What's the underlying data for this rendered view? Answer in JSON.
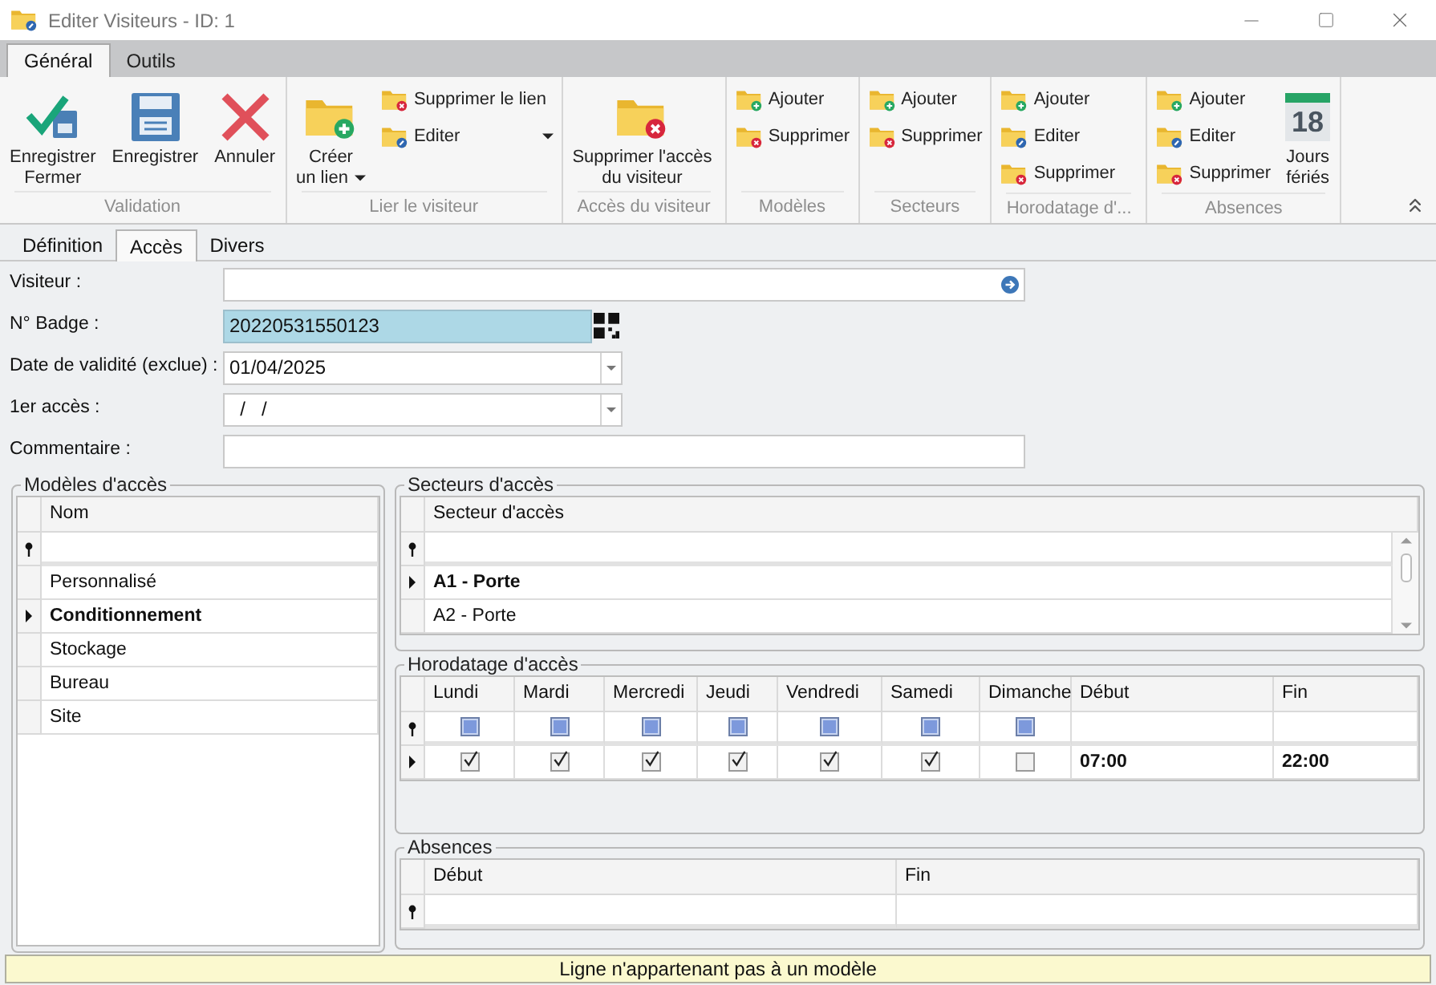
{
  "window": {
    "title": "Editer Visiteurs - ID: 1"
  },
  "ribbon": {
    "tabs": [
      {
        "label": "Général",
        "selected": true
      },
      {
        "label": "Outils",
        "selected": false
      }
    ],
    "groups": [
      {
        "caption": "Validation",
        "buttons": [
          {
            "label": "Enregistrer\nFermer",
            "kind": "save-close",
            "dropdown": false
          },
          {
            "label": "Enregistrer",
            "kind": "save",
            "dropdown": false
          },
          {
            "label": "Annuler",
            "kind": "cancel",
            "dropdown": false
          }
        ]
      },
      {
        "caption": "Lier le visiteur",
        "buttons": [
          {
            "label": "Créer\nun lien",
            "kind": "create",
            "dropdown": true
          },
          {
            "label": "Supprimer le lien",
            "kind": "remove",
            "dropdown": false
          },
          {
            "label": "Editer",
            "kind": "edit",
            "dropdown": true
          }
        ]
      },
      {
        "caption": "Accès du visiteur",
        "buttons": [
          {
            "label": "Supprimer l'accès\ndu visiteur",
            "kind": "delete",
            "dropdown": false
          }
        ]
      },
      {
        "caption": "Modèles",
        "buttons": [
          {
            "label": "Ajouter",
            "kind": "add",
            "dropdown": false
          },
          {
            "label": "Supprimer",
            "kind": "remove",
            "dropdown": false
          }
        ]
      },
      {
        "caption": "Secteurs",
        "buttons": [
          {
            "label": "Ajouter",
            "kind": "add",
            "dropdown": false
          },
          {
            "label": "Supprimer",
            "kind": "remove",
            "dropdown": false
          }
        ]
      },
      {
        "caption": "Horodatage d'...",
        "buttons": [
          {
            "label": "Ajouter",
            "kind": "add",
            "dropdown": false
          },
          {
            "label": "Editer",
            "kind": "edit",
            "dropdown": false
          },
          {
            "label": "Supprimer",
            "kind": "remove",
            "dropdown": false
          }
        ]
      },
      {
        "caption": "Absences",
        "buttons": [
          {
            "label": "Ajouter",
            "kind": "add",
            "dropdown": false
          },
          {
            "label": "Editer",
            "kind": "edit",
            "dropdown": false
          },
          {
            "label": "Supprimer",
            "kind": "remove",
            "dropdown": false
          },
          {
            "label": "Jours\nfériés",
            "kind": "calendar",
            "icon_text": "18",
            "dropdown": false
          }
        ]
      }
    ]
  },
  "page_tabs": [
    {
      "label": "Définition",
      "selected": false
    },
    {
      "label": "Accès",
      "selected": true
    },
    {
      "label": "Divers",
      "selected": false
    }
  ],
  "fields": [
    {
      "label": "Visiteur :",
      "kind": "lookup",
      "focused": false
    },
    {
      "label": "N° Badge :",
      "kind": "badge",
      "value": "20220531550123",
      "focused": true
    },
    {
      "label": "Date de validité (exclue) :",
      "kind": "date",
      "value": "01/04/2025",
      "focused": false
    },
    {
      "label": "1er accès :",
      "kind": "date",
      "value": "  /   /",
      "focused": false
    },
    {
      "label": "Commentaire :",
      "kind": "text",
      "focused": false
    }
  ],
  "modeles": {
    "title": "Modèles d'accès",
    "columns": [
      "Nom"
    ],
    "rows": [
      {
        "name": "Personnalisé",
        "current": false
      },
      {
        "name": "Conditionnement",
        "current": true
      },
      {
        "name": "Stockage",
        "current": false
      },
      {
        "name": "Bureau",
        "current": false
      },
      {
        "name": "Site",
        "current": false
      }
    ]
  },
  "secteurs": {
    "title": "Secteurs d'accès",
    "columns": [
      "Secteur d'accès"
    ],
    "rows": [
      {
        "name": "A1 - Porte",
        "current": true
      },
      {
        "name": "A2 - Porte",
        "current": false
      }
    ]
  },
  "horodatage": {
    "title": "Horodatage d'accès",
    "columns": [
      {
        "label": "Lundi",
        "kind": "day",
        "filter_indeterminate": true
      },
      {
        "label": "Mardi",
        "kind": "day",
        "filter_indeterminate": true
      },
      {
        "label": "Mercredi",
        "kind": "day",
        "filter_indeterminate": true
      },
      {
        "label": "Jeudi",
        "kind": "day",
        "filter_indeterminate": true
      },
      {
        "label": "Vendredi",
        "kind": "day",
        "filter_indeterminate": true
      },
      {
        "label": "Samedi",
        "kind": "day",
        "filter_indeterminate": true
      },
      {
        "label": "Dimanche",
        "kind": "day",
        "filter_indeterminate": true
      },
      {
        "label": "Début",
        "kind": "time"
      },
      {
        "label": "Fin",
        "kind": "time"
      }
    ],
    "rows": [
      {
        "current": true,
        "cells": [
          {
            "checked": true
          },
          {
            "checked": true
          },
          {
            "checked": true
          },
          {
            "checked": true
          },
          {
            "checked": true
          },
          {
            "checked": true
          },
          {
            "checked": false
          },
          {
            "text": "07:00"
          },
          {
            "text": "22:00"
          }
        ]
      }
    ]
  },
  "absences": {
    "title": "Absences",
    "columns": [
      "Début",
      "Fin"
    ]
  },
  "status_bar": {
    "text": "Ligne n'appartenant pas à un modèle"
  }
}
